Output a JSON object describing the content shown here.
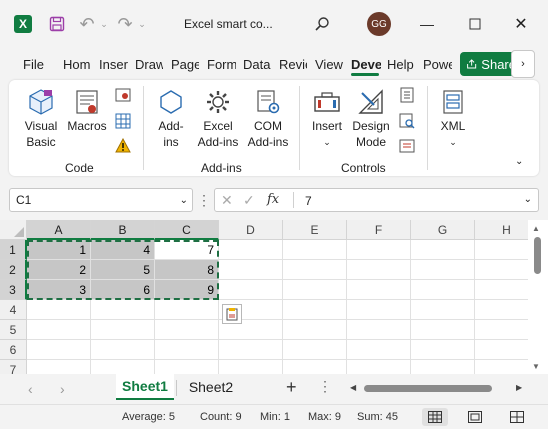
{
  "titlebar": {
    "logo": "X",
    "title": "Excel smart co...",
    "avatar_initials": "GG",
    "icons": [
      "excel-logo",
      "save-icon",
      "undo-icon",
      "redo-icon",
      "search-icon",
      "minimize-icon",
      "maximize-icon",
      "close-icon"
    ]
  },
  "tabs": [
    "File",
    "Hom",
    "Inser",
    "Draw",
    "Page",
    "Form",
    "Data",
    "Revie",
    "View",
    "Deve",
    "Help",
    "Powe"
  ],
  "active_tab": "Deve",
  "share_label": "Share",
  "ribbon": {
    "groups": [
      {
        "label": "Code",
        "buttons": [
          "Visual Basic",
          "Macros"
        ]
      },
      {
        "label": "Add-ins",
        "buttons": [
          "Add-ins",
          "Excel Add-ins",
          "COM Add-ins"
        ]
      },
      {
        "label": "Controls",
        "buttons": [
          "Insert",
          "Design Mode"
        ]
      },
      {
        "label": "",
        "buttons": [
          "XML"
        ]
      }
    ],
    "code": {
      "vb_line1": "Visual",
      "vb_line2": "Basic",
      "macros": "Macros",
      "group": "Code"
    },
    "addins": {
      "addins_line1": "Add-",
      "addins_line2": "ins",
      "excel_line1": "Excel",
      "excel_line2": "Add-ins",
      "com_line1": "COM",
      "com_line2": "Add-ins",
      "group": "Add-ins"
    },
    "controls": {
      "insert": "Insert",
      "design_line1": "Design",
      "design_line2": "Mode",
      "group": "Controls"
    },
    "xml": {
      "label": "XML"
    }
  },
  "formula_bar": {
    "name_box": "C1",
    "value": "7",
    "fx": "fx"
  },
  "grid": {
    "columns": [
      "A",
      "B",
      "C",
      "D",
      "E",
      "F",
      "G",
      "H"
    ],
    "rows": [
      "1",
      "2",
      "3",
      "4",
      "5",
      "6",
      "7"
    ],
    "data": [
      [
        "1",
        "4",
        "7"
      ],
      [
        "2",
        "5",
        "8"
      ],
      [
        "3",
        "6",
        "9"
      ]
    ],
    "selected_range": "A1:C3",
    "active_cell": "C1"
  },
  "sheets": [
    "Sheet1",
    "Sheet2"
  ],
  "active_sheet": "Sheet1",
  "status": {
    "average": "Average: 5",
    "count": "Count: 9",
    "min": "Min: 1",
    "max": "Max: 9",
    "sum": "Sum: 45"
  },
  "colors": {
    "accent": "#107c41",
    "selection": "#c6c6c6",
    "avatar": "#6b3a2a"
  }
}
